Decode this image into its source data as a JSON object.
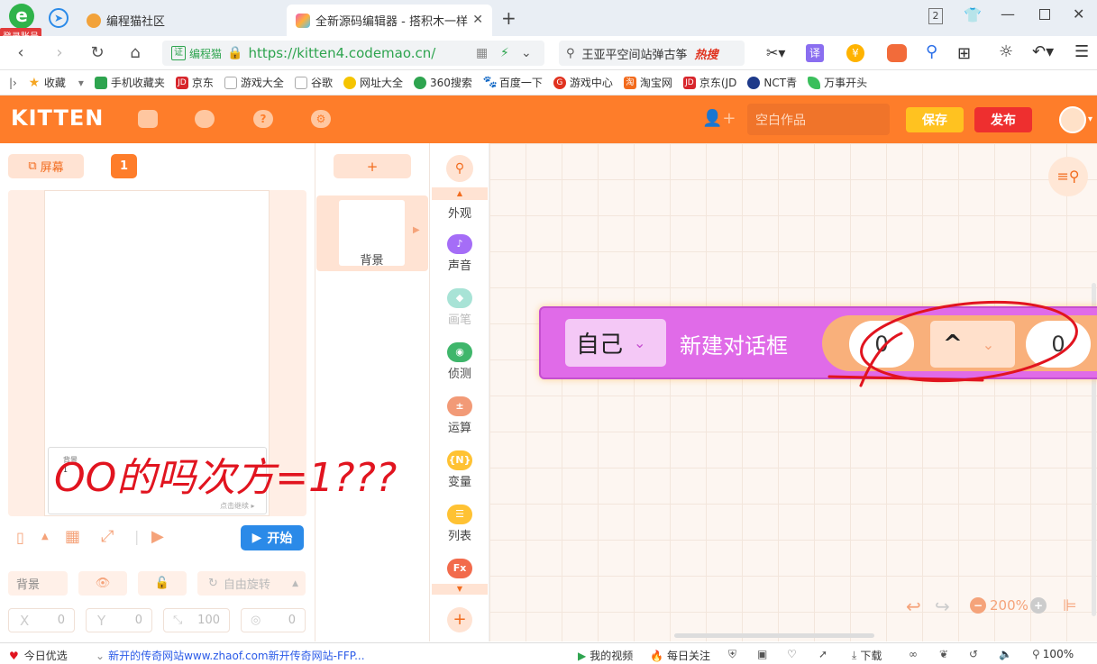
{
  "browser": {
    "login_badge": "登录账号",
    "tabs": [
      {
        "title": "编程猫社区"
      },
      {
        "title": "全新源码编辑器 - 搭积木一样"
      }
    ],
    "tab_count": "2",
    "url_site": "编程猫",
    "url": "https://kitten4.codemao.cn/",
    "search_text": "王亚平空间站弹古筝",
    "search_hot": "热搜",
    "bookmarks": [
      "收藏",
      "手机收藏夹",
      "京东",
      "游戏大全",
      "谷歌",
      "网址大全",
      "360搜索",
      "百度一下",
      "游戏中心",
      "淘宝网",
      "京东(JD",
      "NCT青",
      "万事开头"
    ]
  },
  "kitten": {
    "logo": "KITTEN",
    "work_placeholder": "空白作品",
    "save_label": "保存",
    "publish_label": "发布",
    "screen_label": "屏幕",
    "screen_number": "1",
    "add_label": "+",
    "background_label": "背景",
    "start_label": "开始",
    "dialog_line1": "背景",
    "dialog_line2": "1",
    "dialog_hint": "点击继续 ▸",
    "props": {
      "sprite_name": "背景",
      "rotate": "自由旋转",
      "x_label": "X",
      "x_value": "0",
      "y_label": "Y",
      "y_value": "0",
      "size_value": "100",
      "dir_value": "0"
    },
    "categories": [
      {
        "label": "外观",
        "color": "#ffffff"
      },
      {
        "label": "声音",
        "color": "#a56df7"
      },
      {
        "label": "画笔",
        "color": "#a8e3d6"
      },
      {
        "label": "侦测",
        "color": "#3fb66b"
      },
      {
        "label": "运算",
        "color": "#f29a77"
      },
      {
        "label": "变量",
        "color": "#ffc233"
      },
      {
        "label": "列表",
        "color": "#ffc233"
      },
      {
        "label": "函数",
        "color": "#f26b4c"
      }
    ],
    "block": {
      "target": "自己",
      "text": "新建对话框",
      "value1": "0",
      "operator": "^",
      "value2": "0"
    },
    "zoom": "200%",
    "handwriting": "OO的吗次方=1???"
  },
  "statusbar": {
    "left": "今日优选",
    "news": "新开的传奇网站www.zhaof.com新开传奇网站-FFP...",
    "video": "我的视频",
    "follow": "每日关注",
    "download": "下载",
    "zoom": "100%"
  }
}
